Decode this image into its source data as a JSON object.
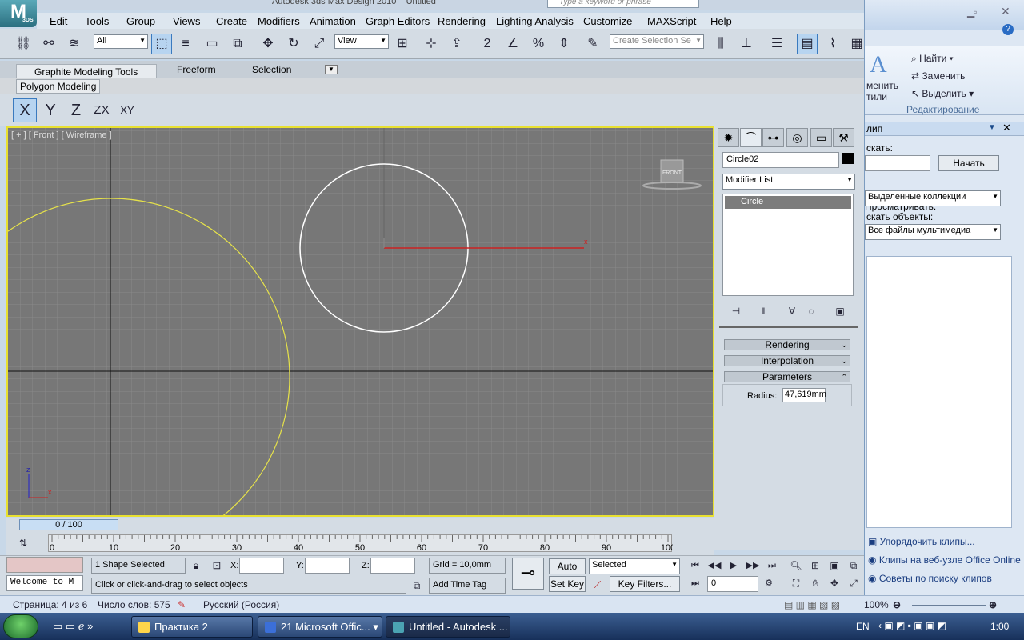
{
  "app": {
    "title": "Autodesk 3ds Max Design 2010",
    "doc": "Untitled",
    "search_placeholder": "Type a keyword or phrase",
    "logo": "3DS"
  },
  "menu": [
    "Edit",
    "Tools",
    "Group",
    "Views",
    "Create",
    "Modifiers",
    "Animation",
    "Graph Editors",
    "Rendering",
    "Lighting Analysis",
    "Customize",
    "MAXScript",
    "Help"
  ],
  "toolbar": {
    "selection_filter": "All",
    "ref_coord": "View",
    "named_selection": "Create Selection Se",
    "snap_2": "2",
    "snap_angle": "",
    "snap_percent": "%"
  },
  "ribbon": {
    "tabs": [
      "Graphite Modeling Tools",
      "Freeform",
      "Selection"
    ],
    "sub_tab": "Polygon Modeling"
  },
  "axis": {
    "x": "X",
    "y": "Y",
    "z": "Z",
    "zx": "ZX",
    "xy": "XY"
  },
  "viewport": {
    "label": "[ + ] [ Front ] [ Wireframe ]",
    "viewcube": "FRONT",
    "gizmo_x": "x",
    "axis_z": "z",
    "axis_x": "x"
  },
  "command_panel": {
    "object_name": "Circle02",
    "modifier_list": "Modifier List",
    "stack_item": "Circle",
    "rollouts": [
      "Rendering",
      "Interpolation",
      "Parameters"
    ],
    "radius_label": "Radius:",
    "radius_value": "47,619mm"
  },
  "timeline": {
    "slider": "0 / 100",
    "ticks": [
      "0",
      "10",
      "20",
      "30",
      "40",
      "50",
      "60",
      "70",
      "80",
      "90",
      "100"
    ]
  },
  "status": {
    "selection": "1 Shape Selected",
    "prompt": "Click or click-and-drag to select objects",
    "x_label": "X:",
    "y_label": "Y:",
    "z_label": "Z:",
    "grid": "Grid = 10,0mm",
    "add_time_tag": "Add Time Tag",
    "auto_key": "Auto Key",
    "set_key": "Set Key",
    "key_mode": "Selected",
    "key_filters": "Key Filters...",
    "frame": "0",
    "maxscript": "Welcome to M"
  },
  "word_pane": {
    "find": "Найти",
    "replace": "Заменить",
    "select": "Выделить",
    "styles_a": "менить",
    "styles_b": "тили",
    "group": "Редактирование",
    "clip_title": "лип",
    "search_label": "скать:",
    "start_btn": "Начать",
    "browse_label": "Просматривать:",
    "browse_value": "Выделенные коллекции",
    "objects_label": "скать объекты:",
    "objects_value": "Все файлы мультимедиа",
    "links": [
      "Упорядочить клипы...",
      "Клипы на веб-узле Office Online",
      "Советы по поиску клипов"
    ]
  },
  "word_status": {
    "page": "Страница: 4 из 6",
    "words": "Число слов: 575",
    "lang": "Русский (Россия)",
    "zoom": "100%"
  },
  "taskbar": {
    "items": [
      "Практика 2",
      "21 Microsoft Offic...",
      "Untitled - Autodesk ..."
    ],
    "lang": "EN",
    "time": "1:00"
  },
  "colors": {
    "viewport_bg": "#777777",
    "active_border": "#e8e030",
    "selected_circle": "#ffffff",
    "other_circle": "#e6e24a"
  }
}
